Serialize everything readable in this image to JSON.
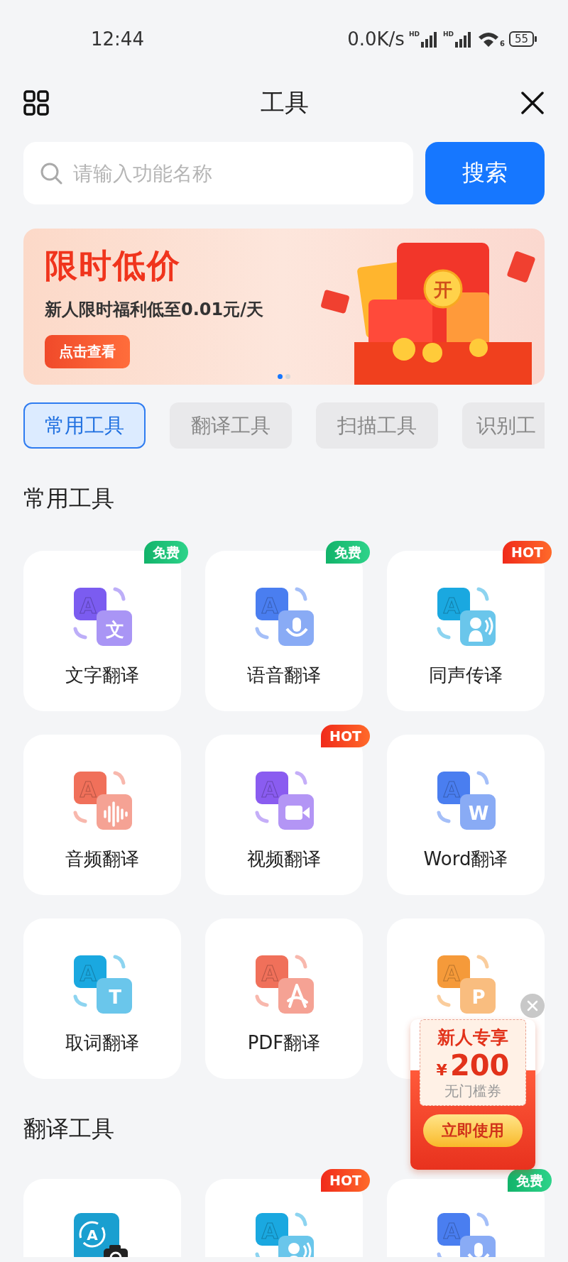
{
  "status_bar": {
    "time": "12:44",
    "speed": "0.0K/s",
    "sim_labels": [
      "HD",
      "HD"
    ],
    "wifi_label": "6",
    "battery": "55"
  },
  "header": {
    "title": "工具"
  },
  "search": {
    "placeholder": "请输入功能名称",
    "button": "搜索"
  },
  "banner": {
    "title": "限时低价",
    "subtitle": "新人限时福利低至**0.01元/天**",
    "button": "点击查看",
    "gift_label": "开",
    "dots": [
      {
        "selected": true
      },
      {
        "selected": false
      }
    ]
  },
  "tabs": [
    {
      "label": "常用工具",
      "selected": true
    },
    {
      "label": "翻译工具",
      "selected": false
    },
    {
      "label": "扫描工具",
      "selected": false
    },
    {
      "label": "识别工",
      "selected": false
    }
  ],
  "sections": [
    {
      "title": "常用工具",
      "items": [
        {
          "label": "文字翻译",
          "badge": {
            "text": "免费",
            "kind": "free"
          },
          "icon": {
            "kind": "glyph",
            "letter": "A",
            "glyph": "文",
            "color": "#7b5cf0"
          }
        },
        {
          "label": "语音翻译",
          "badge": {
            "text": "免费",
            "kind": "free"
          },
          "icon": {
            "kind": "mic",
            "letter": "A",
            "color": "#4a7ef0"
          }
        },
        {
          "label": "同声传译",
          "badge": {
            "text": "HOT",
            "kind": "hot"
          },
          "icon": {
            "kind": "speaker",
            "letter": "A",
            "color": "#1aa8e0"
          }
        },
        {
          "label": "音频翻译",
          "icon": {
            "kind": "wave",
            "letter": "A",
            "color": "#f0705a"
          }
        },
        {
          "label": "视频翻译",
          "badge": {
            "text": "HOT",
            "kind": "hot"
          },
          "icon": {
            "kind": "video",
            "letter": "A",
            "color": "#8a5cf0"
          }
        },
        {
          "label": "Word翻译",
          "icon": {
            "kind": "glyph",
            "letter": "A",
            "glyph": "W",
            "color": "#4a7ef0"
          }
        },
        {
          "label": "取词翻译",
          "icon": {
            "kind": "glyph",
            "letter": "A",
            "glyph": "T",
            "color": "#1aa8e0"
          }
        },
        {
          "label": "PDF翻译",
          "icon": {
            "kind": "pdf",
            "letter": "A",
            "color": "#f0705a"
          }
        },
        {
          "icon": {
            "kind": "glyph",
            "letter": "A",
            "glyph": "P",
            "color": "#f59a3a"
          }
        }
      ]
    },
    {
      "title": "翻译工具",
      "items": [
        {
          "icon": {
            "kind": "camera",
            "letter": "A",
            "color": "#1a9fd0"
          }
        },
        {
          "badge": {
            "text": "HOT",
            "kind": "hot"
          },
          "icon": {
            "kind": "speaker",
            "letter": "A",
            "color": "#1aa8e0"
          }
        },
        {
          "badge": {
            "text": "免费",
            "kind": "free"
          },
          "icon": {
            "kind": "mic",
            "letter": "A",
            "color": "#4a7ef0"
          }
        }
      ]
    }
  ],
  "coupon": {
    "title": "新人专享",
    "currency": "¥",
    "amount": "200",
    "note": "无门槛券",
    "button": "立即使用"
  }
}
